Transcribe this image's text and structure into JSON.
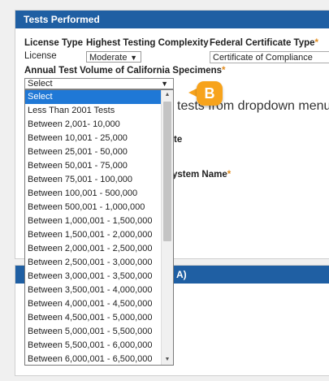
{
  "section1": {
    "title": "Tests Performed",
    "license_type_label": "License Type",
    "license_type_value": "License",
    "complexity_label": "Highest Testing Complexity",
    "complexity_value": "Moderate",
    "cert_type_label": "Federal Certificate Type",
    "cert_type_value": "Certificate of Compliance",
    "annual_volume_label": "Annual Test Volume of California Specimens",
    "required_marker": "*",
    "bg_instruction_text": "tests from dropdown menu C",
    "bg_partial_label_1": "te",
    "bg_partial_label_2": "ystem Name"
  },
  "section2": {
    "title_fragment": "A)"
  },
  "dropdown": {
    "current_value": "Select",
    "options": [
      "Select",
      "Less Than 2001 Tests",
      "Between 2,001- 10,000",
      "Between 10,001 - 25,000",
      "Between 25,001 - 50,000",
      "Between 50,001 - 75,000",
      "Between 75,001 - 100,000",
      "Between 100,001 - 500,000",
      "Between 500,001 - 1,000,000",
      "Between 1,000,001 - 1,500,000",
      "Between 1,500,001 - 2,000,000",
      "Between 2,000,001 - 2,500,000",
      "Between 2,500,001 - 3,000,000",
      "Between 3,000,001 - 3,500,000",
      "Between 3,500,001 - 4,000,000",
      "Between 4,000,001 - 4,500,000",
      "Between 4,500,001 - 5,000,000",
      "Between 5,000,001 - 5,500,000",
      "Between 5,500,001 - 6,000,000",
      "Between 6,000,001 - 6,500,000"
    ],
    "selected_index": 0
  },
  "callout": {
    "letter": "B"
  },
  "colors": {
    "header_blue": "#1f5fa3",
    "selection_blue": "#1f78d6",
    "callout_orange": "#f7a31c",
    "required_orange": "#e08a1c"
  }
}
